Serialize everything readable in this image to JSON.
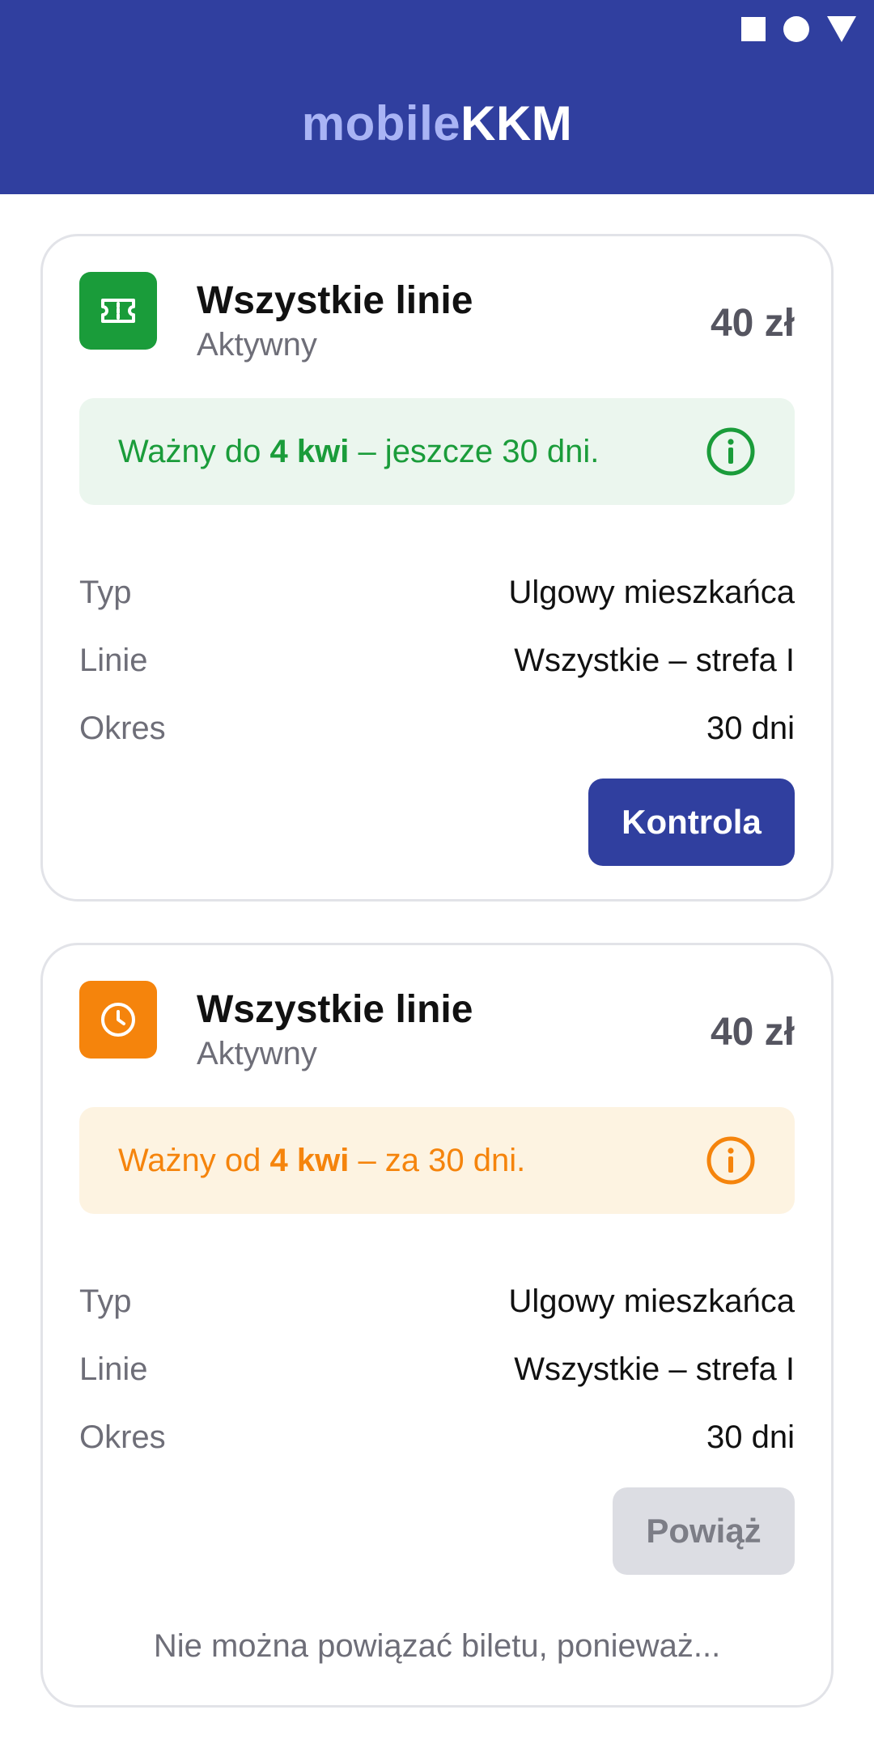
{
  "app": {
    "title_light": "mobile",
    "title_strong": "KKM"
  },
  "colors": {
    "primary": "#303f9f",
    "active_green": "#1a9c3a",
    "pending_orange": "#f5840c",
    "green_bg": "#ebf6ee",
    "orange_bg": "#fdf3e1"
  },
  "tickets": [
    {
      "title": "Wszystkie linie",
      "status": "Aktywny",
      "price": "40 zł",
      "icon": "ticket-icon",
      "validity": {
        "prefix": "Ważny do ",
        "date": "4 kwi",
        "suffix": " – jeszcze 30 dni."
      },
      "details": [
        {
          "label": "Typ",
          "value": "Ulgowy mieszkańca"
        },
        {
          "label": "Linie",
          "value": "Wszystkie – strefa I"
        },
        {
          "label": "Okres",
          "value": "30 dni"
        }
      ],
      "button_label": "Kontrola"
    },
    {
      "title": "Wszystkie linie",
      "status": "Aktywny",
      "price": "40 zł",
      "icon": "clock-icon",
      "validity": {
        "prefix": "Ważny od ",
        "date": "4 kwi",
        "suffix": " – za 30 dni."
      },
      "details": [
        {
          "label": "Typ",
          "value": "Ulgowy mieszkańca"
        },
        {
          "label": "Linie",
          "value": "Wszystkie – strefa I"
        },
        {
          "label": "Okres",
          "value": "30 dni"
        }
      ],
      "button_label": "Powiąż",
      "button_disabled": true,
      "note": "Nie można powiązać biletu, ponieważ..."
    }
  ]
}
